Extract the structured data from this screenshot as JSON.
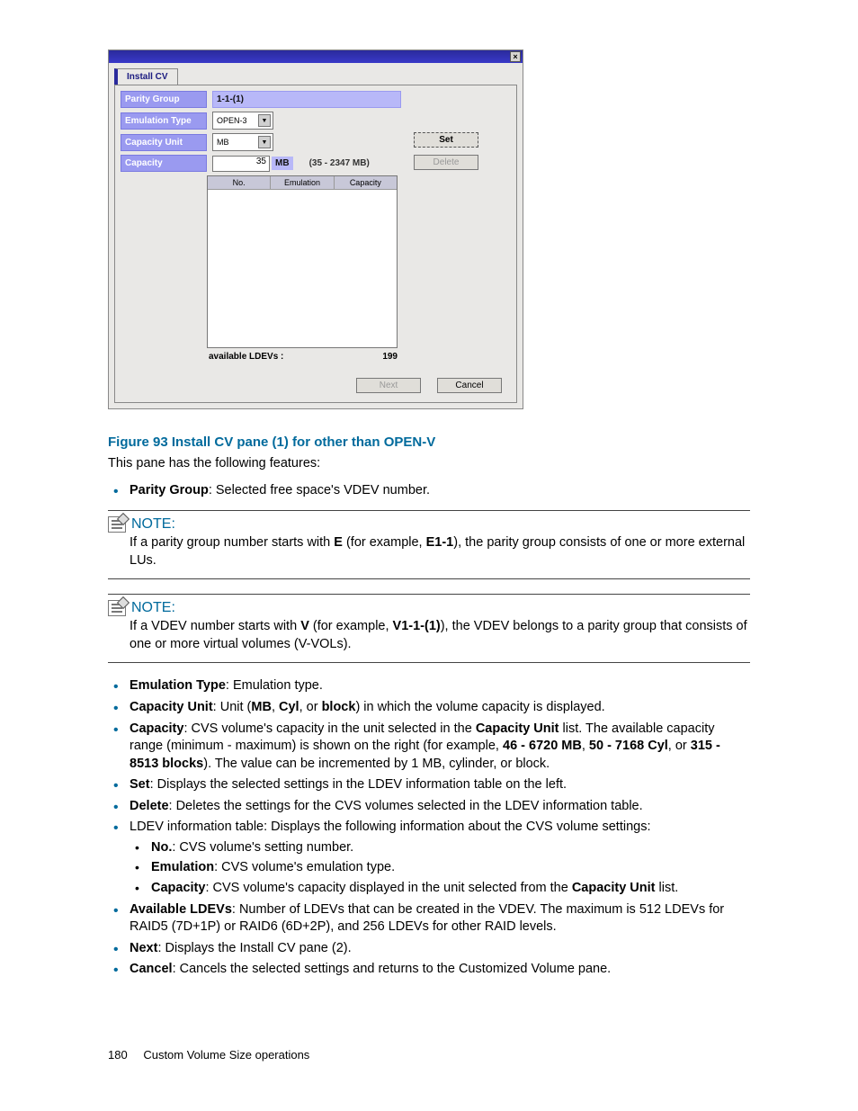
{
  "dialog": {
    "tab": "Install CV",
    "close": "×",
    "labels": {
      "parity_group": "Parity Group",
      "emulation_type": "Emulation Type",
      "capacity_unit": "Capacity Unit",
      "capacity": "Capacity"
    },
    "values": {
      "parity_group": "1-1-(1)",
      "emulation_type": "OPEN-3",
      "capacity_unit": "MB",
      "capacity": "35",
      "cap_unit_badge": "MB",
      "cap_range": "(35 - 2347 MB)"
    },
    "table_headers": {
      "no": "No.",
      "emu": "Emulation",
      "cap": "Capacity"
    },
    "available_label": "available LDEVs :",
    "available_value": "199",
    "buttons": {
      "set": "Set",
      "delete": "Delete",
      "next": "Next",
      "cancel": "Cancel"
    }
  },
  "figure_caption": "Figure 93 Install CV pane (1) for other than OPEN-V",
  "intro": "This pane has the following features:",
  "bullets_top": {
    "parity": {
      "term": "Parity Group",
      "desc": ":  Selected free space's VDEV number."
    }
  },
  "notes": {
    "n1": {
      "title": "NOTE:",
      "pre": "If a parity group number starts with ",
      "bold1": "E",
      "mid": " (for example, ",
      "bold2": "E1-1",
      "post": "), the parity group consists of one or more external LUs."
    },
    "n2": {
      "title": "NOTE:",
      "pre": "If a VDEV number starts with ",
      "bold1": "V",
      "mid": " (for example, ",
      "bold2": "V1-1-(1)",
      "post": "), the VDEV belongs to a parity group that consists of one or more virtual volumes (V-VOLs)."
    }
  },
  "bullets": {
    "emu": {
      "term": "Emulation Type",
      "desc": ":  Emulation type."
    },
    "capunit": {
      "term": "Capacity Unit",
      "d1": ": Unit (",
      "b1": "MB",
      "c1": ", ",
      "b2": "Cyl",
      "c2": ", or ",
      "b3": "block",
      "d2": ") in which the volume capacity is displayed."
    },
    "cap": {
      "term": "Capacity",
      "d1": ": CVS volume's capacity in the unit selected in the ",
      "b1": "Capacity Unit",
      "d2": " list.  The available capacity range (minimum - maximum) is shown on the right (for example, ",
      "b2": "46 - 6720 MB",
      "c1": ", ",
      "b3": "50 - 7168 Cyl",
      "c2": ", or ",
      "b4": "315 - 8513 blocks",
      "d3": ").  The value can be incremented by 1 MB, cylinder, or block."
    },
    "set": {
      "term": "Set",
      "desc": ": Displays the selected settings in the LDEV information table on the left."
    },
    "del": {
      "term": "Delete",
      "desc": ": Deletes the settings for the CVS volumes selected in the LDEV information table."
    },
    "ldev_intro": "LDEV information table:  Displays the following information about the CVS volume settings:",
    "sub": {
      "no": {
        "term": "No.",
        "desc": ":  CVS volume's setting number."
      },
      "emu": {
        "term": "Emulation",
        "desc": ":  CVS volume's emulation type."
      },
      "cap": {
        "term": "Capacity",
        "d1": ":  CVS volume's capacity displayed in the unit selected from the ",
        "b1": "Capacity Unit",
        "d2": " list."
      }
    },
    "avail": {
      "term": "Available LDEVs",
      "desc": ": Number of LDEVs that can be created in the VDEV. The maximum is 512 LDEVs for RAID5 (7D+1P) or RAID6 (6D+2P), and 256 LDEVs for other RAID levels."
    },
    "next": {
      "term": "Next",
      "desc": ": Displays the Install CV pane (2)."
    },
    "cancel": {
      "term": "Cancel",
      "desc": ": Cancels the selected settings and returns to the Customized Volume pane."
    }
  },
  "footer": {
    "page": "180",
    "section": "Custom Volume Size operations"
  }
}
